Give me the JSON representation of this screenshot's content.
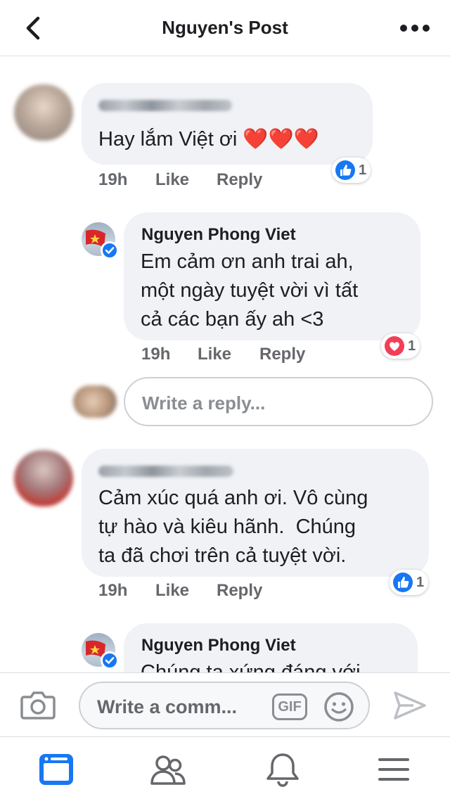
{
  "header": {
    "title": "Nguyen's Post"
  },
  "comments": [
    {
      "text": "Hay lắm Việt ơi ❤️❤️❤️",
      "time": "19h",
      "like_label": "Like",
      "reply_label": "Reply",
      "reaction": {
        "type": "like",
        "count": "1"
      }
    },
    {
      "author": "Nguyen Phong Viet",
      "text_lines": [
        "Em cảm ơn anh trai ah,",
        "một ngày tuyệt vời vì tất",
        "cả các bạn ấy ah <3"
      ],
      "time": "19h",
      "like_label": "Like",
      "reply_label": "Reply",
      "reaction": {
        "type": "love",
        "count": "1"
      }
    },
    {
      "text_lines": [
        "Cảm xúc quá anh ơi. Vô cùng",
        "tự hào và kiêu hãnh.  Chúng",
        "ta đã chơi trên cả tuyệt vời."
      ],
      "time": "19h",
      "like_label": "Like",
      "reply_label": "Reply",
      "reaction": {
        "type": "like",
        "count": "1"
      }
    },
    {
      "author": "Nguyen Phong Viet",
      "text_partial": "Chúng ta xứng đáng với"
    }
  ],
  "reply_box": {
    "placeholder": "Write a reply..."
  },
  "composer": {
    "placeholder": "Write a comm...",
    "gif_label": "GIF"
  },
  "tabbar": {
    "items": [
      "news-feed",
      "friends",
      "notifications",
      "menu"
    ],
    "active": "news-feed"
  },
  "colors": {
    "accent": "#1877f2",
    "love": "#f33e58",
    "bubble": "#f0f2f5",
    "meta_text": "#65676b"
  }
}
